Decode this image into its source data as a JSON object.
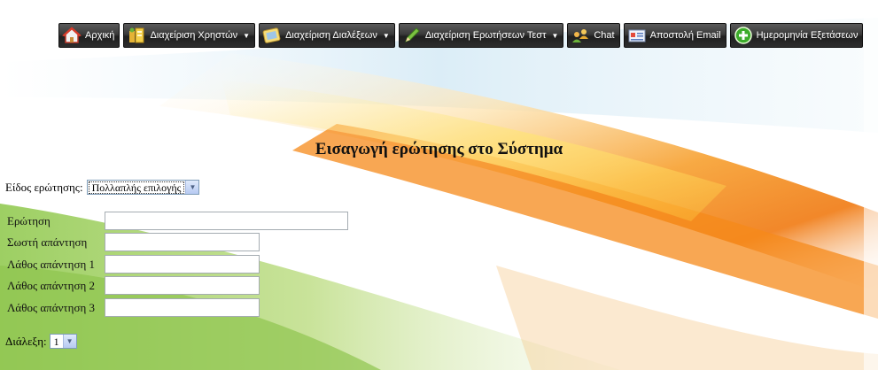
{
  "nav": {
    "items": [
      {
        "label": "Αρχική",
        "icon": "home-icon",
        "dropdown": false
      },
      {
        "label": "Διαχείριση Χρηστών",
        "icon": "users-icon",
        "dropdown": true
      },
      {
        "label": "Διαχείριση Διαλέξεων",
        "icon": "lectures-icon",
        "dropdown": true
      },
      {
        "label": "Διαχείριση Ερωτήσεων Τεστ",
        "icon": "pencil-icon",
        "dropdown": true
      },
      {
        "label": "Chat",
        "icon": "chat-icon",
        "dropdown": false
      },
      {
        "label": "Αποστολή Email",
        "icon": "email-icon",
        "dropdown": false
      },
      {
        "label": "Ημερομηνία Εξετάσεων",
        "icon": "add-icon",
        "dropdown": false
      }
    ]
  },
  "page": {
    "title": "Εισαγωγή ερώτησης στο Σύστημα"
  },
  "question_type": {
    "label": "Είδος ερώτησης:",
    "selected": "Πολλαπλής επιλογής"
  },
  "form": {
    "question_label": "Ερώτηση",
    "correct_label": "Σωστή απάντηση",
    "wrong1_label": "Λάθος απάντηση 1",
    "wrong2_label": "Λάθος απάντηση 2",
    "wrong3_label": "Λάθος απάντηση 3",
    "question_value": "",
    "correct_value": "",
    "wrong1_value": "",
    "wrong2_value": "",
    "wrong3_value": ""
  },
  "lecture": {
    "label": "Διάλεξη:",
    "selected": "1"
  },
  "colors": {
    "accent_orange": "#f39420",
    "accent_green": "#9ccb5a",
    "nav_bg": "#2d2d2d"
  }
}
